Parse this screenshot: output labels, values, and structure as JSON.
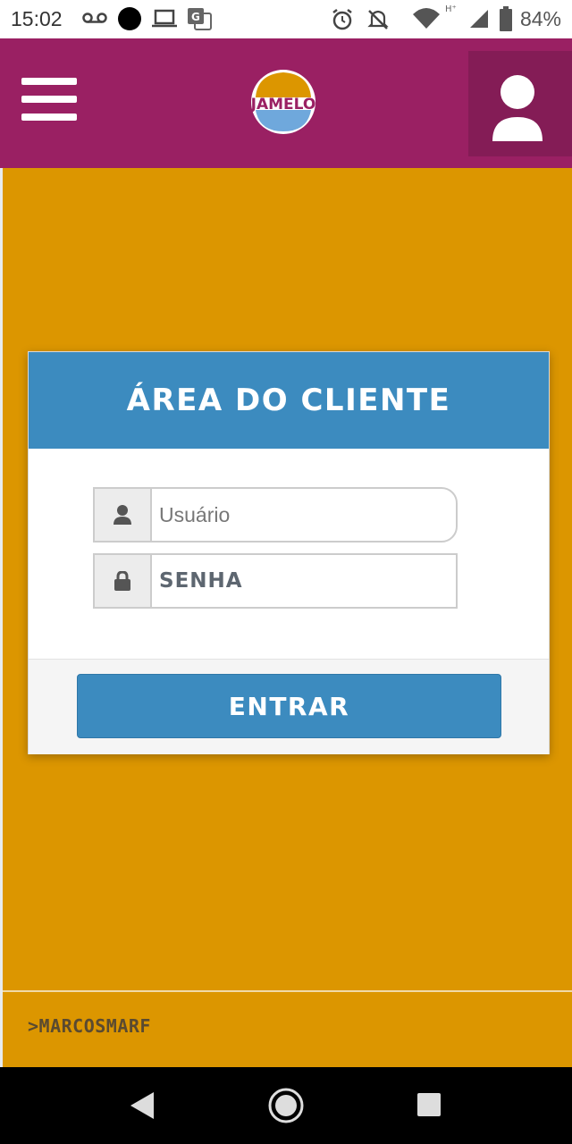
{
  "status_bar": {
    "time": "15:02",
    "battery": "84%",
    "icons": [
      "voicemail-icon",
      "notification-dot-icon",
      "laptop-icon",
      "translate-icon",
      "alarm-icon",
      "bell-off-icon",
      "wifi-icon",
      "signal-icon",
      "battery-icon"
    ]
  },
  "header": {
    "menu_icon": "hamburger-menu-icon",
    "logo_text": "JAMELO",
    "user_icon": "user-icon",
    "colors": {
      "background": "#9a2063",
      "user_button": "#841c56"
    }
  },
  "login": {
    "title": "ÁREA DO CLIENTE",
    "username_placeholder": "Usuário",
    "password_placeholder": "SENHA",
    "submit_label": "ENTRAR",
    "colors": {
      "accent": "#3c8bbf",
      "page_background": "#dc9600"
    }
  },
  "footer": {
    "credit": ">MARCOSMARF"
  }
}
